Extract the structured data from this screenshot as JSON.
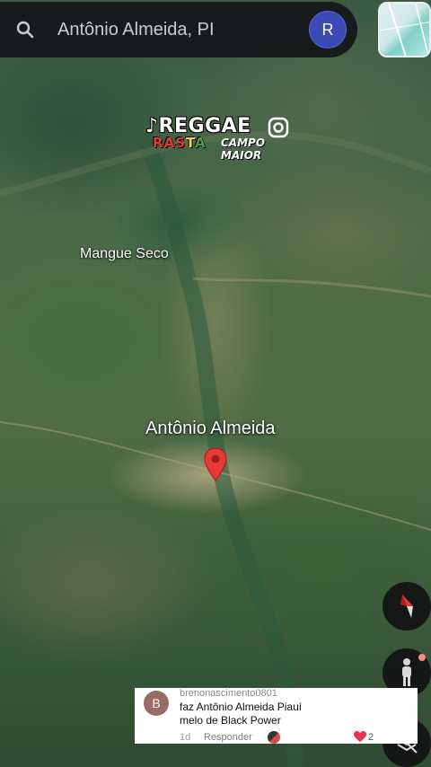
{
  "search": {
    "query": "Antônio Almeida, PI",
    "icon": "search-icon"
  },
  "account": {
    "initial": "R",
    "color": "#3c4ab5"
  },
  "watermark": {
    "line1": "♪REGGAE",
    "rasta": [
      "RAS",
      "T",
      "A"
    ],
    "subtitle": "CAMPO MAIOR"
  },
  "map": {
    "places": {
      "secondary": "Mangue Seco",
      "primary": "Antônio Almeida"
    },
    "pin_color": "#e53935"
  },
  "controls": {
    "compass": "compass-icon",
    "street_view": "pegman-icon",
    "layers": "layers-icon"
  },
  "comment": {
    "avatar_initial": "B",
    "username": "brenonascimento0801",
    "line1": "faz Antônio Almeida Piauí",
    "line2": "melo de Black Power",
    "time": "1d",
    "reply_label": "Responder",
    "likes": "2"
  }
}
